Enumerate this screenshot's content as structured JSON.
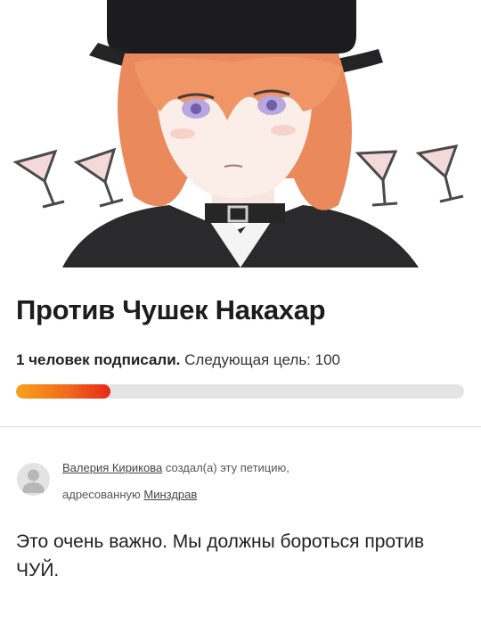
{
  "petition": {
    "title": "Против Чушек Накахар",
    "signers_count_text": "1 человек подписали.",
    "next_goal_text": "Следующая цель: 100",
    "progress_fraction": 0.21
  },
  "creator": {
    "name": "Валерия Кирикова",
    "created_text": "создал(а) эту петицию,",
    "addressed_text": "адресованную",
    "recipient": "Минздрав"
  },
  "body": {
    "text": "Это очень важно. Мы должны бороться против ЧУЙ."
  },
  "colors": {
    "progress_start": "#f7a21b",
    "progress_end": "#e8281a",
    "track": "#e4e4e4"
  },
  "icons": {
    "avatar": "user-silhouette-icon"
  }
}
